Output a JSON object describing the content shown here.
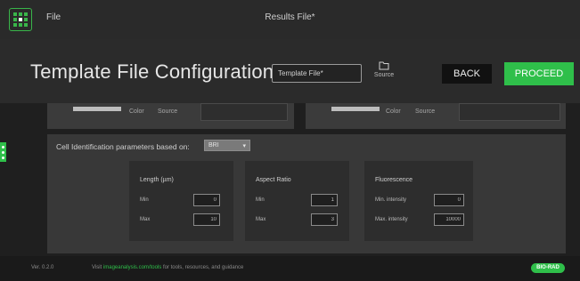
{
  "topbar": {
    "file_menu": "File",
    "window_title": "Results File*"
  },
  "header": {
    "page_title": "Template File Configuration",
    "template_input_value": "Template File*",
    "source_label": "Source",
    "back_label": "BACK",
    "proceed_label": "PROCEED"
  },
  "color_panels": {
    "left": {
      "color_label": "Color",
      "source_label": "Source"
    },
    "right": {
      "color_label": "Color",
      "source_label": "Source"
    }
  },
  "cell_identification": {
    "label": "Cell Identification parameters based on:",
    "based_on_value": "BRI",
    "cards": [
      {
        "title": "Length (µm)",
        "rows": [
          {
            "label": "Min",
            "value": "0"
          },
          {
            "label": "Max",
            "value": "10"
          }
        ]
      },
      {
        "title": "Aspect Ratio",
        "rows": [
          {
            "label": "Min",
            "value": "1"
          },
          {
            "label": "Max",
            "value": "3"
          }
        ]
      },
      {
        "title": "Fluorescence",
        "rows": [
          {
            "label": "Min. intensity",
            "value": "0"
          },
          {
            "label": "Max. intensity",
            "value": "10000"
          }
        ]
      }
    ]
  },
  "footer": {
    "version": "Ver. 0.2.0",
    "visit_prefix": "Visit",
    "visit_link": "imageanalysis.com/tools",
    "visit_suffix": "for tools, resources, and guidance",
    "brand": "BIO-RAD"
  },
  "colors": {
    "accent_green": "#2fbf4a",
    "background": "#1f1f1f",
    "panel": "#383838",
    "card": "#2d2d2d"
  },
  "icons": [
    "app-logo-icon",
    "folder-icon",
    "side-tab-icon",
    "chevron-down-icon"
  ]
}
